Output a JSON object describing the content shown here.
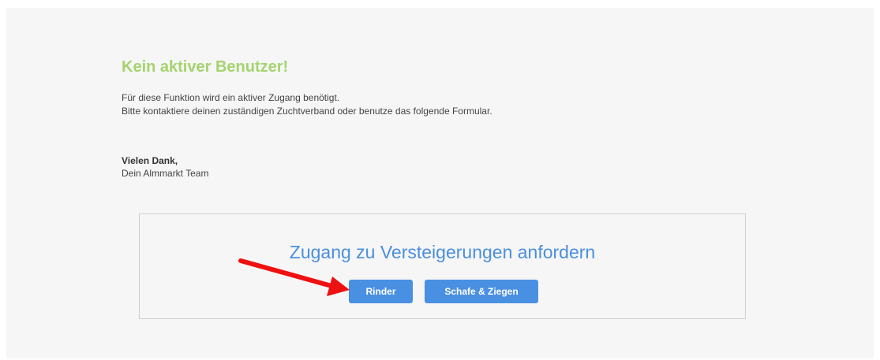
{
  "notice": {
    "title": "Kein aktiver Benutzer!",
    "line1": "Für diese Funktion wird ein aktiver Zugang benötigt.",
    "line2": "Bitte kontaktiere deinen zuständigen Zuchtverband oder benutze das folgende Formular.",
    "thanks": "Vielen Dank,",
    "team": "Dein Almmarkt Team"
  },
  "request": {
    "title": "Zugang zu Versteigerungen anfordern",
    "buttons": {
      "rinder": "Rinder",
      "schafe": "Schafe & Ziegen"
    }
  },
  "colors": {
    "title_green": "#a5d36e",
    "accent_blue": "#4a90e2",
    "arrow_red": "#ee1111"
  },
  "annotation_icon": "red-arrow-icon"
}
